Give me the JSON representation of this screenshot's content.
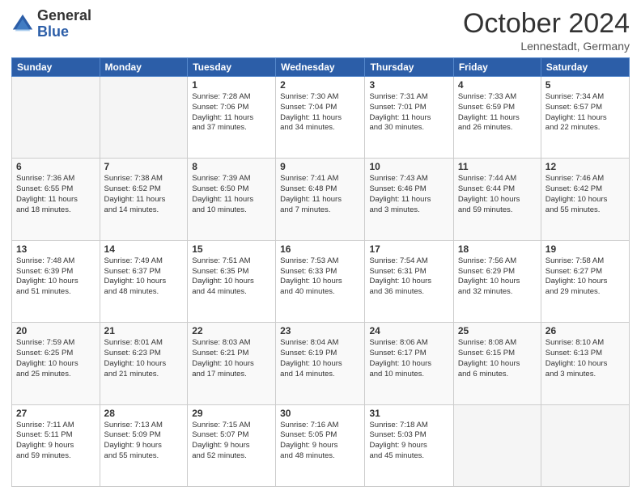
{
  "header": {
    "logo_general": "General",
    "logo_blue": "Blue",
    "month_title": "October 2024",
    "location": "Lennestadt, Germany"
  },
  "weekdays": [
    "Sunday",
    "Monday",
    "Tuesday",
    "Wednesday",
    "Thursday",
    "Friday",
    "Saturday"
  ],
  "rows": [
    [
      {
        "day": "",
        "detail": ""
      },
      {
        "day": "",
        "detail": ""
      },
      {
        "day": "1",
        "detail": "Sunrise: 7:28 AM\nSunset: 7:06 PM\nDaylight: 11 hours\nand 37 minutes."
      },
      {
        "day": "2",
        "detail": "Sunrise: 7:30 AM\nSunset: 7:04 PM\nDaylight: 11 hours\nand 34 minutes."
      },
      {
        "day": "3",
        "detail": "Sunrise: 7:31 AM\nSunset: 7:01 PM\nDaylight: 11 hours\nand 30 minutes."
      },
      {
        "day": "4",
        "detail": "Sunrise: 7:33 AM\nSunset: 6:59 PM\nDaylight: 11 hours\nand 26 minutes."
      },
      {
        "day": "5",
        "detail": "Sunrise: 7:34 AM\nSunset: 6:57 PM\nDaylight: 11 hours\nand 22 minutes."
      }
    ],
    [
      {
        "day": "6",
        "detail": "Sunrise: 7:36 AM\nSunset: 6:55 PM\nDaylight: 11 hours\nand 18 minutes."
      },
      {
        "day": "7",
        "detail": "Sunrise: 7:38 AM\nSunset: 6:52 PM\nDaylight: 11 hours\nand 14 minutes."
      },
      {
        "day": "8",
        "detail": "Sunrise: 7:39 AM\nSunset: 6:50 PM\nDaylight: 11 hours\nand 10 minutes."
      },
      {
        "day": "9",
        "detail": "Sunrise: 7:41 AM\nSunset: 6:48 PM\nDaylight: 11 hours\nand 7 minutes."
      },
      {
        "day": "10",
        "detail": "Sunrise: 7:43 AM\nSunset: 6:46 PM\nDaylight: 11 hours\nand 3 minutes."
      },
      {
        "day": "11",
        "detail": "Sunrise: 7:44 AM\nSunset: 6:44 PM\nDaylight: 10 hours\nand 59 minutes."
      },
      {
        "day": "12",
        "detail": "Sunrise: 7:46 AM\nSunset: 6:42 PM\nDaylight: 10 hours\nand 55 minutes."
      }
    ],
    [
      {
        "day": "13",
        "detail": "Sunrise: 7:48 AM\nSunset: 6:39 PM\nDaylight: 10 hours\nand 51 minutes."
      },
      {
        "day": "14",
        "detail": "Sunrise: 7:49 AM\nSunset: 6:37 PM\nDaylight: 10 hours\nand 48 minutes."
      },
      {
        "day": "15",
        "detail": "Sunrise: 7:51 AM\nSunset: 6:35 PM\nDaylight: 10 hours\nand 44 minutes."
      },
      {
        "day": "16",
        "detail": "Sunrise: 7:53 AM\nSunset: 6:33 PM\nDaylight: 10 hours\nand 40 minutes."
      },
      {
        "day": "17",
        "detail": "Sunrise: 7:54 AM\nSunset: 6:31 PM\nDaylight: 10 hours\nand 36 minutes."
      },
      {
        "day": "18",
        "detail": "Sunrise: 7:56 AM\nSunset: 6:29 PM\nDaylight: 10 hours\nand 32 minutes."
      },
      {
        "day": "19",
        "detail": "Sunrise: 7:58 AM\nSunset: 6:27 PM\nDaylight: 10 hours\nand 29 minutes."
      }
    ],
    [
      {
        "day": "20",
        "detail": "Sunrise: 7:59 AM\nSunset: 6:25 PM\nDaylight: 10 hours\nand 25 minutes."
      },
      {
        "day": "21",
        "detail": "Sunrise: 8:01 AM\nSunset: 6:23 PM\nDaylight: 10 hours\nand 21 minutes."
      },
      {
        "day": "22",
        "detail": "Sunrise: 8:03 AM\nSunset: 6:21 PM\nDaylight: 10 hours\nand 17 minutes."
      },
      {
        "day": "23",
        "detail": "Sunrise: 8:04 AM\nSunset: 6:19 PM\nDaylight: 10 hours\nand 14 minutes."
      },
      {
        "day": "24",
        "detail": "Sunrise: 8:06 AM\nSunset: 6:17 PM\nDaylight: 10 hours\nand 10 minutes."
      },
      {
        "day": "25",
        "detail": "Sunrise: 8:08 AM\nSunset: 6:15 PM\nDaylight: 10 hours\nand 6 minutes."
      },
      {
        "day": "26",
        "detail": "Sunrise: 8:10 AM\nSunset: 6:13 PM\nDaylight: 10 hours\nand 3 minutes."
      }
    ],
    [
      {
        "day": "27",
        "detail": "Sunrise: 7:11 AM\nSunset: 5:11 PM\nDaylight: 9 hours\nand 59 minutes."
      },
      {
        "day": "28",
        "detail": "Sunrise: 7:13 AM\nSunset: 5:09 PM\nDaylight: 9 hours\nand 55 minutes."
      },
      {
        "day": "29",
        "detail": "Sunrise: 7:15 AM\nSunset: 5:07 PM\nDaylight: 9 hours\nand 52 minutes."
      },
      {
        "day": "30",
        "detail": "Sunrise: 7:16 AM\nSunset: 5:05 PM\nDaylight: 9 hours\nand 48 minutes."
      },
      {
        "day": "31",
        "detail": "Sunrise: 7:18 AM\nSunset: 5:03 PM\nDaylight: 9 hours\nand 45 minutes."
      },
      {
        "day": "",
        "detail": ""
      },
      {
        "day": "",
        "detail": ""
      }
    ]
  ]
}
